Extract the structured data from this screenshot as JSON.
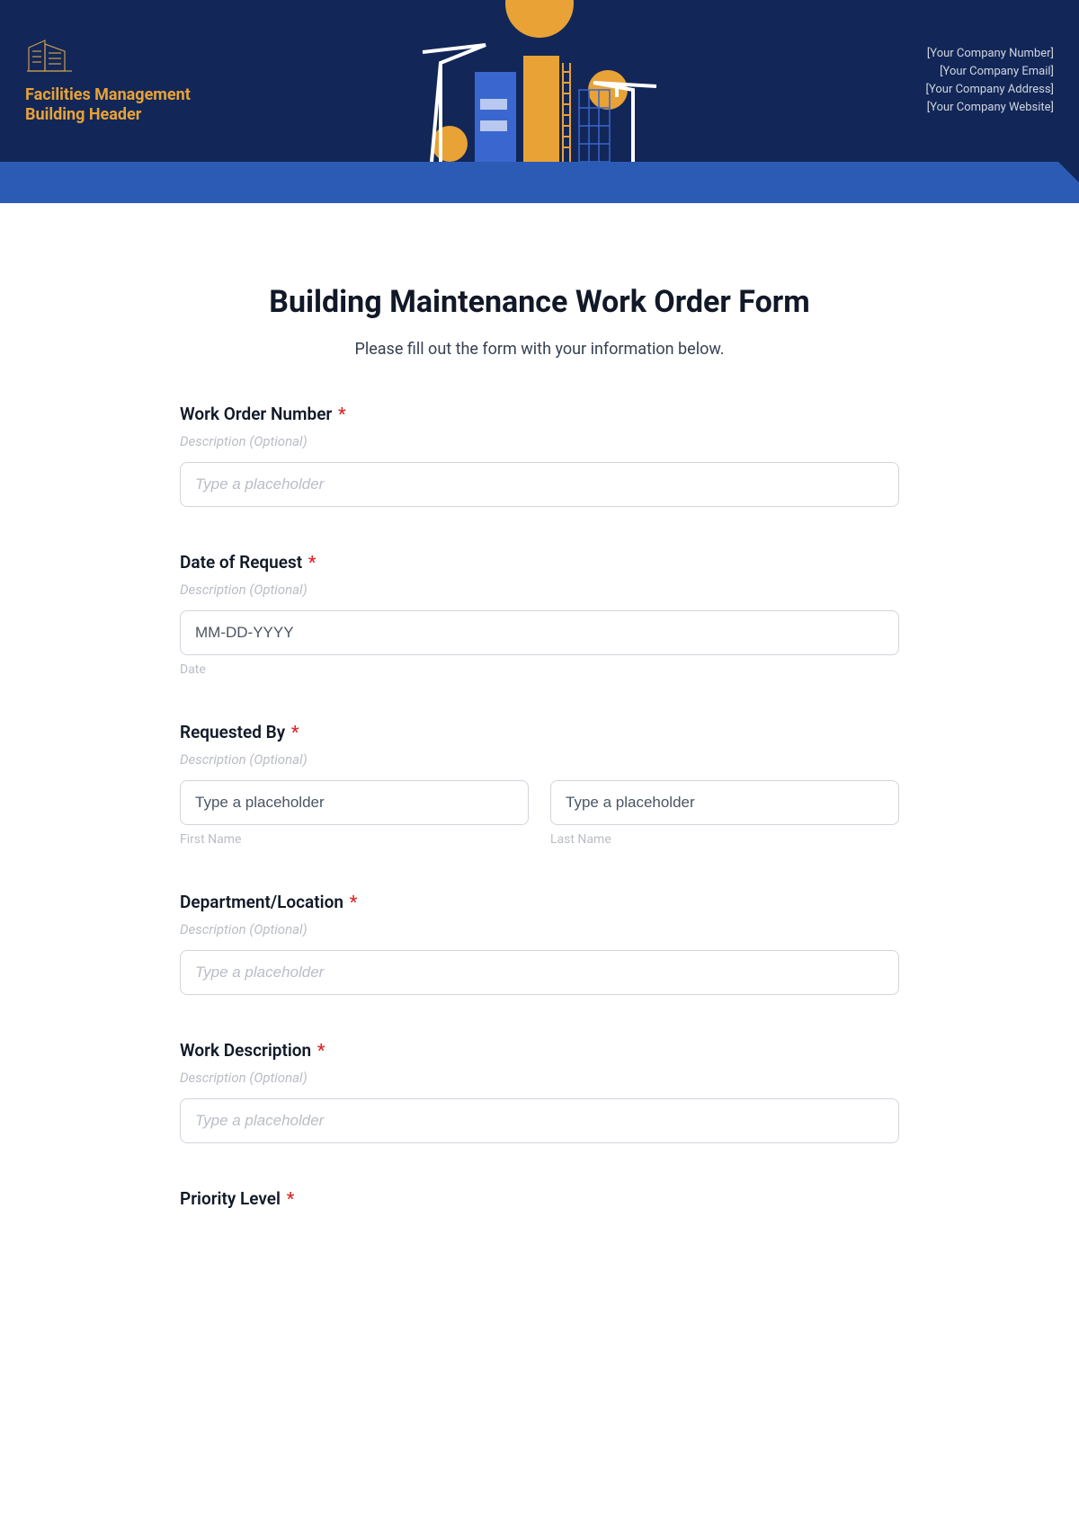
{
  "header": {
    "logo_line1": "Facilities Management",
    "logo_line2": "Building Header",
    "company": {
      "number": "[Your Company Number]",
      "email": "[Your Company Email]",
      "address": "[Your Company Address]",
      "website": "[Your Company Website]"
    }
  },
  "form": {
    "title": "Building Maintenance Work Order Form",
    "subtitle": "Please fill out the form with your information below.",
    "desc_placeholder": "Description (Optional)",
    "fields": {
      "work_order_number": {
        "label": "Work Order Number",
        "placeholder": "Type a placeholder"
      },
      "date_of_request": {
        "label": "Date of Request",
        "placeholder": "MM-DD-YYYY",
        "sublabel": "Date"
      },
      "requested_by": {
        "label": "Requested By",
        "first_placeholder": "Type a placeholder",
        "last_placeholder": "Type a placeholder",
        "first_sublabel": "First Name",
        "last_sublabel": "Last Name"
      },
      "department_location": {
        "label": "Department/Location",
        "placeholder": "Type a placeholder"
      },
      "work_description": {
        "label": "Work Description",
        "placeholder": "Type a placeholder"
      },
      "priority_level": {
        "label": "Priority Level"
      }
    },
    "required_mark": "*"
  }
}
